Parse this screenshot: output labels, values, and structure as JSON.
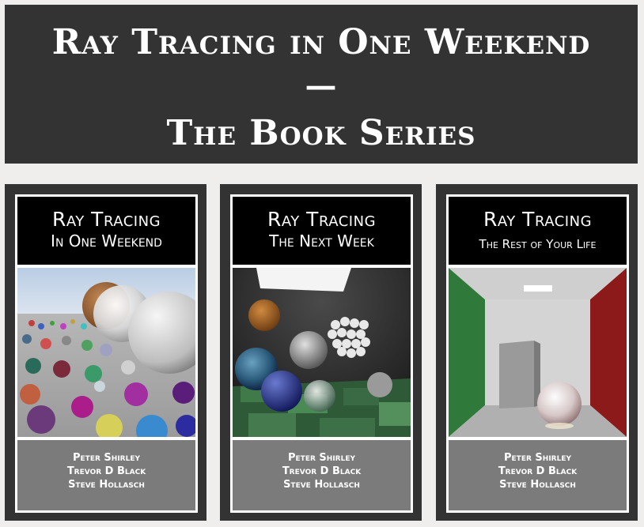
{
  "banner": {
    "line1": "Ray Tracing in One Weekend",
    "dash": "—",
    "line2": "The Book Series"
  },
  "books": [
    {
      "title": "Ray Tracing",
      "subtitle": "In One Weekend",
      "authors": [
        "Peter Shirley",
        "Trevor D Black",
        "Steve Hollasch"
      ]
    },
    {
      "title": "Ray Tracing",
      "subtitle": "The Next Week",
      "authors": [
        "Peter Shirley",
        "Trevor D Black",
        "Steve Hollasch"
      ]
    },
    {
      "title": "Ray Tracing",
      "subtitle": "The Rest of Your Life",
      "authors": [
        "Peter Shirley",
        "Trevor D Black",
        "Steve Hollasch"
      ]
    }
  ],
  "colors": {
    "background": "#efeeec",
    "panel": "#333333",
    "title_band": "#000000",
    "author_band": "#7b7b7b"
  }
}
